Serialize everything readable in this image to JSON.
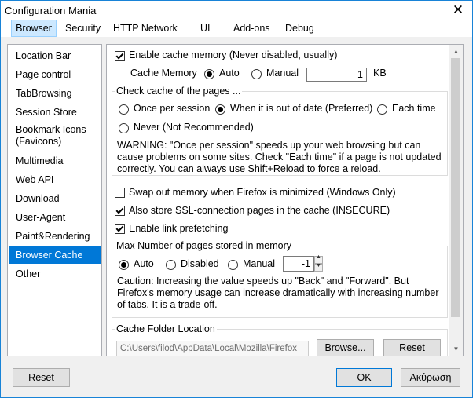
{
  "window": {
    "title": "Configuration Mania",
    "close_glyph": "✕"
  },
  "menu": [
    "Browser",
    "Security",
    "HTTP Network",
    "UI",
    "Add-ons",
    "Debug"
  ],
  "nav": [
    "Location Bar",
    "Page control",
    "TabBrowsing",
    "Session Store",
    "Bookmark Icons\n(Favicons)",
    "Multimedia",
    "Web API",
    "Download",
    "User-Agent",
    "Paint&Rendering",
    "Browser Cache",
    "Other"
  ],
  "content": {
    "enable_cache_memory": "Enable cache memory (Never disabled, usually)",
    "cache_memory_label": "Cache Memory",
    "auto": "Auto",
    "manual": "Manual",
    "cache_memory_value": "-1",
    "kb": "KB",
    "check_cache_title": "Check cache of the pages ...",
    "once_per_session": "Once per session",
    "when_out_of_date": "When it is out of date (Preferred)",
    "each_time": "Each time",
    "never": "Never (Not Recommended)",
    "warning": "WARNING: \"Once per session\" speeds up your web browsing but can cause problems on some sites. Check \"Each time\" if a page is not updated correctly. You can always use Shift+Reload to force a reload.",
    "swap_out": "Swap out memory when Firefox is minimized (Windows Only)",
    "store_ssl": "Also store SSL-connection pages in the cache (INSECURE)",
    "link_prefetch": "Enable link prefetching",
    "max_pages_title": "Max Number of pages stored in memory",
    "auto2": "Auto",
    "disabled": "Disabled",
    "manual2": "Manual",
    "max_pages_value": "-1",
    "caution": "Caution: Increasing the value speeds up \"Back\" and \"Forward\". But Firefox's memory usage can increase dramatically with increasing number of tabs. It is a trade-off.",
    "cache_folder_title": "Cache Folder Location",
    "cache_folder_path": "C:\\Users\\filod\\AppData\\Local\\Mozilla\\Firefox",
    "browse": "Browse...",
    "reset_folder": "Reset"
  },
  "footer": {
    "reset": "Reset",
    "ok": "OK",
    "cancel": "Ακύρωση"
  },
  "colors": {
    "accent": "#0078d7",
    "selection_bg": "#cce8ff"
  }
}
